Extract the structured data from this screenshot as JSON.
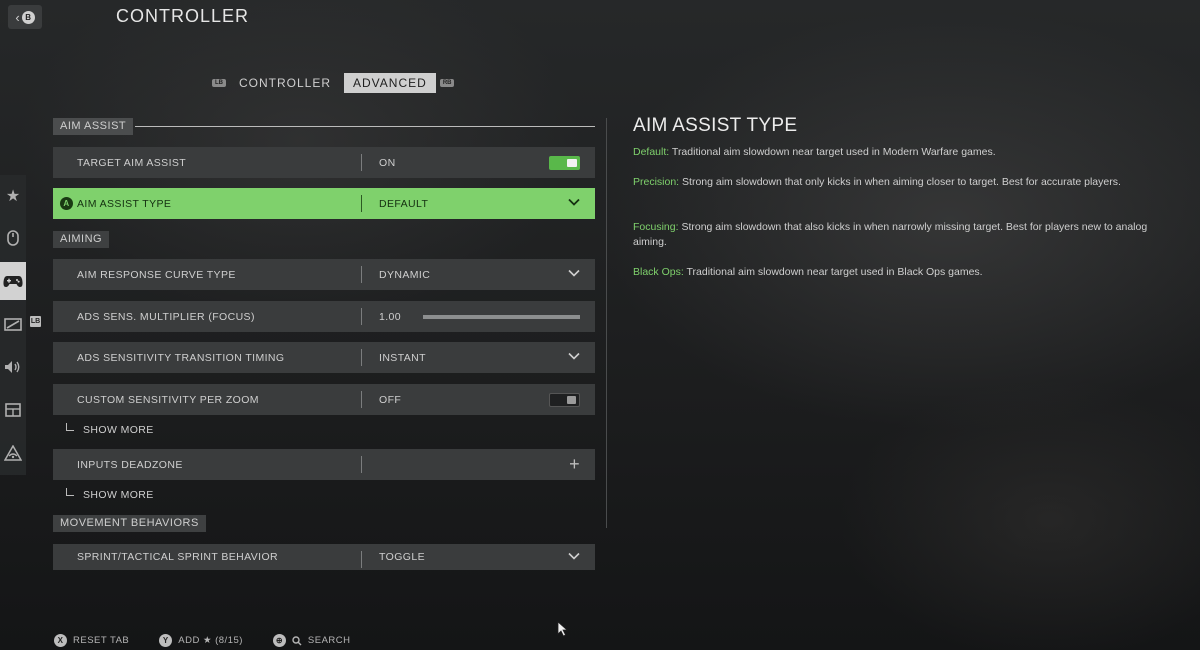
{
  "header": {
    "back_glyph": "B",
    "title": "CONTROLLER"
  },
  "tabs": {
    "left_bumper": "LB",
    "right_bumper": "RB",
    "items": [
      {
        "label": "CONTROLLER",
        "active": false
      },
      {
        "label": "ADVANCED",
        "active": true
      }
    ]
  },
  "sidebar": {
    "icons": [
      "star-icon",
      "mouse-icon",
      "gamepad-icon",
      "display-icon",
      "speaker-icon",
      "interface-icon",
      "network-icon"
    ],
    "active_index": 2,
    "tag": "LB"
  },
  "sections": {
    "aim_assist": "AIM ASSIST",
    "aiming": "AIMING",
    "movement": "MOVEMENT BEHAVIORS"
  },
  "rows": {
    "target_aim_assist": {
      "label": "TARGET AIM ASSIST",
      "value": "ON"
    },
    "aim_assist_type": {
      "glyph": "A",
      "label": "AIM ASSIST TYPE",
      "value": "DEFAULT"
    },
    "aim_response_curve": {
      "label": "AIM RESPONSE CURVE TYPE",
      "value": "DYNAMIC"
    },
    "ads_sens_multiplier": {
      "label": "ADS SENS. MULTIPLIER (FOCUS)",
      "value": "1.00"
    },
    "ads_transition_timing": {
      "label": "ADS SENSITIVITY TRANSITION TIMING",
      "value": "INSTANT"
    },
    "custom_sens_per_zoom": {
      "label": "CUSTOM SENSITIVITY PER ZOOM",
      "value": "OFF"
    },
    "inputs_deadzone": {
      "label": "INPUTS DEADZONE"
    },
    "sprint_behavior": {
      "label": "SPRINT/TACTICAL SPRINT BEHAVIOR",
      "value": "TOGGLE"
    }
  },
  "show_more_label": "SHOW MORE",
  "detail": {
    "title": "AIM ASSIST TYPE",
    "entries": [
      {
        "key": "Default:",
        "text": " Traditional aim slowdown near target used in Modern Warfare games."
      },
      {
        "key": "Precision:",
        "text": " Strong aim slowdown that only kicks in when aiming closer to target. Best for accurate players."
      },
      {
        "key": "Focusing:",
        "text": " Strong aim slowdown that also kicks in when narrowly missing target. Best for players new to analog aiming."
      },
      {
        "key": "Black Ops:",
        "text": " Traditional aim slowdown near target used in Black Ops games."
      }
    ]
  },
  "footer": {
    "reset_glyph": "X",
    "reset_label": "RESET TAB",
    "add_glyph": "Y",
    "add_label": "ADD ★ (8/15)",
    "search_glyph": "⊕",
    "search_label": "SEARCH"
  },
  "colors": {
    "accent": "#7fd16c",
    "row_bg": "#3a3c3d",
    "toggle_on": "#59b84a"
  }
}
